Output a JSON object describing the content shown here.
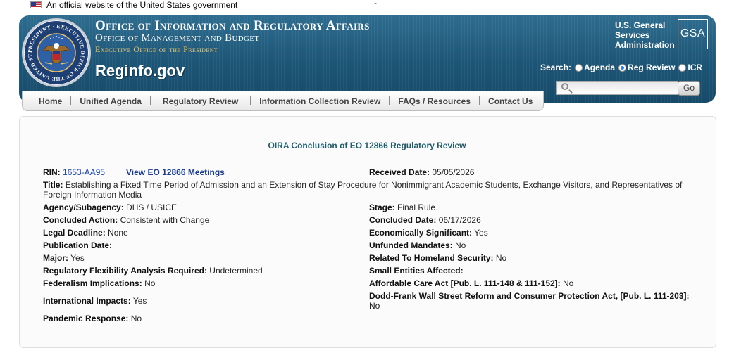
{
  "banner": {
    "text": "An official website of the United States government",
    "dash": "-"
  },
  "header": {
    "oira": "Office of Information and Regulatory Affairs",
    "omb": "Office of Management and Budget",
    "eop": "Executive Office of the President",
    "site": "Reginfo.gov",
    "gsa_lines": [
      "U.S. General",
      "Services",
      "Administration"
    ],
    "gsa_logo": "GSA",
    "seal_text": "PRESIDENT · EXECUTIVE OFFICE OF THE UNITED STATES",
    "search": {
      "label": "Search:",
      "options": [
        "Agenda",
        "Reg Review",
        "ICR"
      ],
      "selected": "Reg Review",
      "placeholder": "",
      "go": "Go"
    }
  },
  "nav": [
    "Home",
    "Unified Agenda",
    "Regulatory Review",
    "Information Collection Review",
    "FAQs / Resources",
    "Contact Us"
  ],
  "page": {
    "heading": "OIRA Conclusion of EO 12866 Regulatory Review",
    "rin_label": "RIN:",
    "rin_value": "1653-AA95",
    "eo_link": "View EO 12866 Meetings",
    "received_label": "Received Date:",
    "received_value": "05/05/2026",
    "title_label": "Title:",
    "title_value": "Establishing a Fixed Time Period of Admission and an Extension of Stay Procedure for Nonimmigrant Academic Students, Exchange Visitors, and Representatives of Foreign Information Media",
    "left": [
      {
        "label": "Agency/Subagency:",
        "value": "DHS / USICE"
      },
      {
        "label": "Concluded Action:",
        "value": "Consistent with Change"
      },
      {
        "label": "Legal Deadline:",
        "value": "None"
      },
      {
        "label": "Publication Date:",
        "value": ""
      },
      {
        "label": "Major:",
        "value": "Yes"
      },
      {
        "label": "Regulatory Flexibility Analysis Required:",
        "value": "Undetermined"
      },
      {
        "label": "Federalism Implications:",
        "value": "No"
      },
      {
        "label": "International Impacts:",
        "value": "Yes"
      },
      {
        "label": "Pandemic Response:",
        "value": "No"
      }
    ],
    "right": [
      {
        "label": "Stage:",
        "value": "Final Rule"
      },
      {
        "label": "Concluded Date:",
        "value": "06/17/2026"
      },
      {
        "label": "Economically Significant:",
        "value": "Yes"
      },
      {
        "label": "Unfunded Mandates:",
        "value": "No"
      },
      {
        "label": "Related To Homeland Security:",
        "value": "No"
      },
      {
        "label": "Small Entities Affected:",
        "value": ""
      },
      {
        "label": "Affordable Care Act [Pub. L. 111-148 & 111-152]:",
        "value": "No"
      },
      {
        "label": "Dodd-Frank Wall Street Reform and Consumer Protection Act, [Pub. L. 111-203]:",
        "value": "No"
      }
    ]
  }
}
